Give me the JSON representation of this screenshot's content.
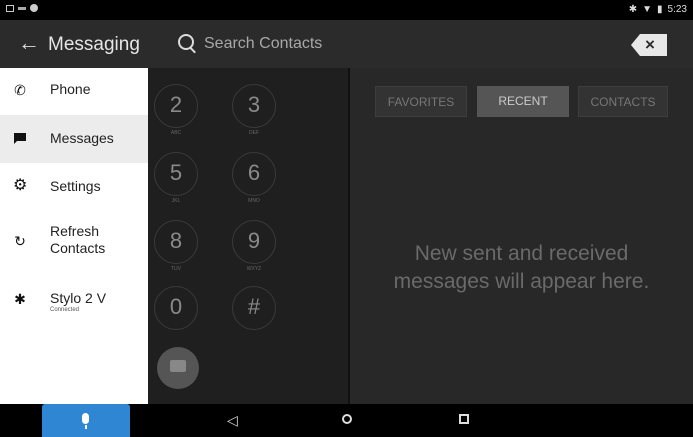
{
  "status_bar": {
    "time": "5:23"
  },
  "header": {
    "back_icon": "arrow-back-icon",
    "title": "Messaging",
    "search_placeholder": "Search Contacts",
    "clear_icon": "backspace-icon"
  },
  "sidebar": {
    "items": [
      {
        "label": "Phone",
        "icon": "phone-icon"
      },
      {
        "label": "Messages",
        "icon": "message-icon",
        "selected": true
      },
      {
        "label": "Settings",
        "icon": "gear-icon"
      },
      {
        "label": "Refresh",
        "label2": "Contacts",
        "icon": "refresh-icon"
      },
      {
        "label": "Stylo 2 V",
        "sub": "Connected",
        "icon": "bluetooth-icon"
      }
    ]
  },
  "dialpad": {
    "keys": [
      {
        "digit": "2",
        "letters": "ABC"
      },
      {
        "digit": "3",
        "letters": "DEF"
      },
      {
        "digit": "5",
        "letters": "JKL"
      },
      {
        "digit": "6",
        "letters": "MNO"
      },
      {
        "digit": "8",
        "letters": "TUV"
      },
      {
        "digit": "9",
        "letters": "WXYZ"
      },
      {
        "digit": "0",
        "letters": ""
      },
      {
        "digit": "#",
        "letters": ""
      }
    ]
  },
  "tabs": [
    {
      "label": "FAVORITES",
      "active": false
    },
    {
      "label": "RECENT",
      "active": true
    },
    {
      "label": "CONTACTS",
      "active": false
    }
  ],
  "content": {
    "empty_line1": "New sent and received",
    "empty_line2": "messages will appear here."
  },
  "colors": {
    "accent": "#2f86d2",
    "topbar": "#2b2b2b",
    "sidebar": "#ffffff"
  }
}
